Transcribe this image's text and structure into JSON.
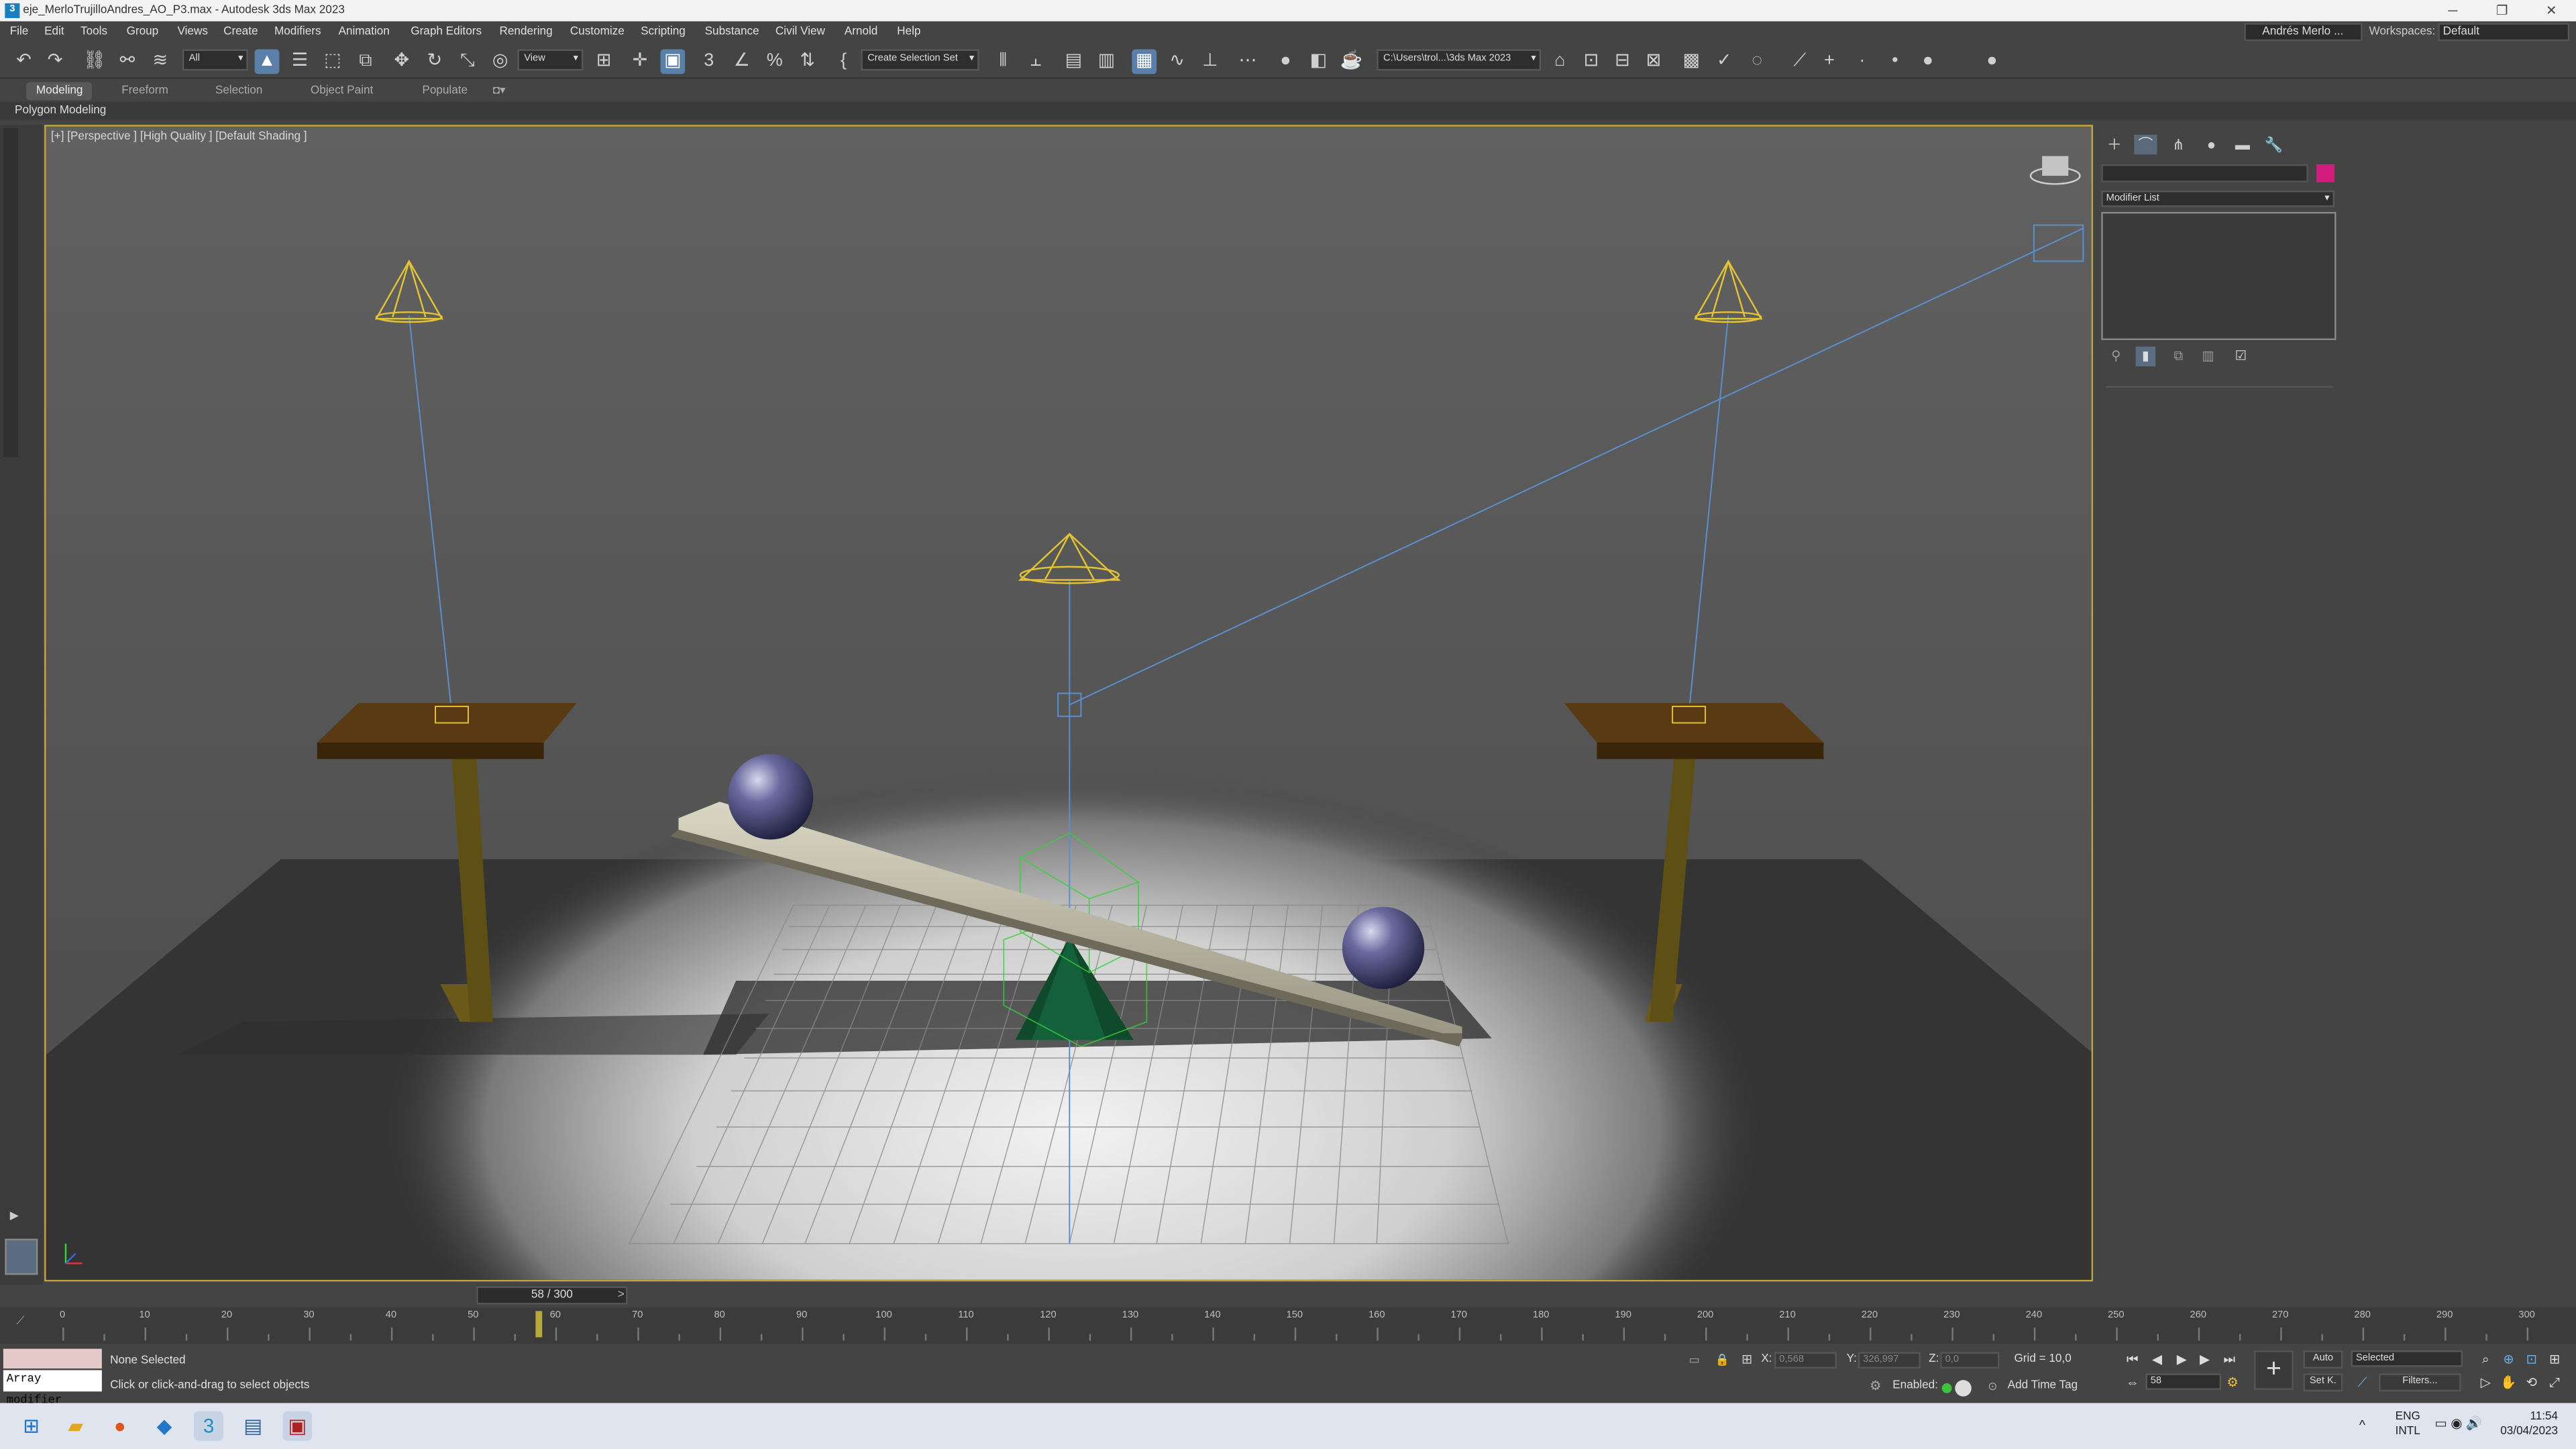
{
  "window": {
    "title": "eje_MerloTrujilloAndres_AO_P3.max - Autodesk 3ds Max 2023",
    "app_icon": "3"
  },
  "menu": [
    "File",
    "Edit",
    "Tools",
    "Group",
    "Views",
    "Create",
    "Modifiers",
    "Animation",
    "Graph Editors",
    "Rendering",
    "Customize",
    "Scripting",
    "Substance",
    "Civil View",
    "Arnold",
    "Help"
  ],
  "account": {
    "user": "Andrés Merlo ...",
    "workspaces_label": "Workspaces:",
    "workspace": "Default"
  },
  "toolbar": {
    "selection_filter": "All",
    "ref_coord": "View",
    "named_selection": "Create Selection Set",
    "project_path": "C:\\Users\\trol...\\3ds Max 2023"
  },
  "ribbon": {
    "tabs": [
      "Modeling",
      "Freeform",
      "Selection",
      "Object Paint",
      "Populate"
    ],
    "active": "Modeling",
    "subtab": "Polygon Modeling"
  },
  "viewport": {
    "label": "[+] [Perspective ] [High Quality ] [Default Shading ]",
    "selection_color": "#c8a438"
  },
  "command_panel": {
    "modifier_list": "Modifier List",
    "object_color": "#d41b7e"
  },
  "time": {
    "current_frame": 58,
    "total_frames": 300,
    "frame_label": "58 / 300",
    "ruler_labels": [
      "0",
      "10",
      "20",
      "30",
      "40",
      "50",
      "60",
      "70",
      "80",
      "90",
      "100",
      "110",
      "120",
      "130",
      "140",
      "150",
      "160",
      "170",
      "180",
      "190",
      "200",
      "210",
      "220",
      "230",
      "240",
      "250",
      "260",
      "270",
      "280",
      "290",
      "300"
    ]
  },
  "status": {
    "maxscript_line": "Array modifier",
    "selection": "None Selected",
    "prompt": "Click or click-and-drag to select objects",
    "x_label": "X:",
    "x_value": "0,568",
    "y_label": "Y:",
    "y_value": "326,997",
    "z_label": "Z:",
    "z_value": "0,0",
    "grid": "Grid = 10,0",
    "enabled_label": "Enabled:",
    "add_time_tag": "Add Time Tag",
    "auto_key": "Auto",
    "set_key": "Set K.",
    "key_filter": "Selected",
    "filters": "Filters...",
    "frame": "58"
  },
  "taskbar": {
    "lang_top": "ENG",
    "lang_bottom": "INTL",
    "time": "11:54",
    "date": "03/04/2023"
  }
}
